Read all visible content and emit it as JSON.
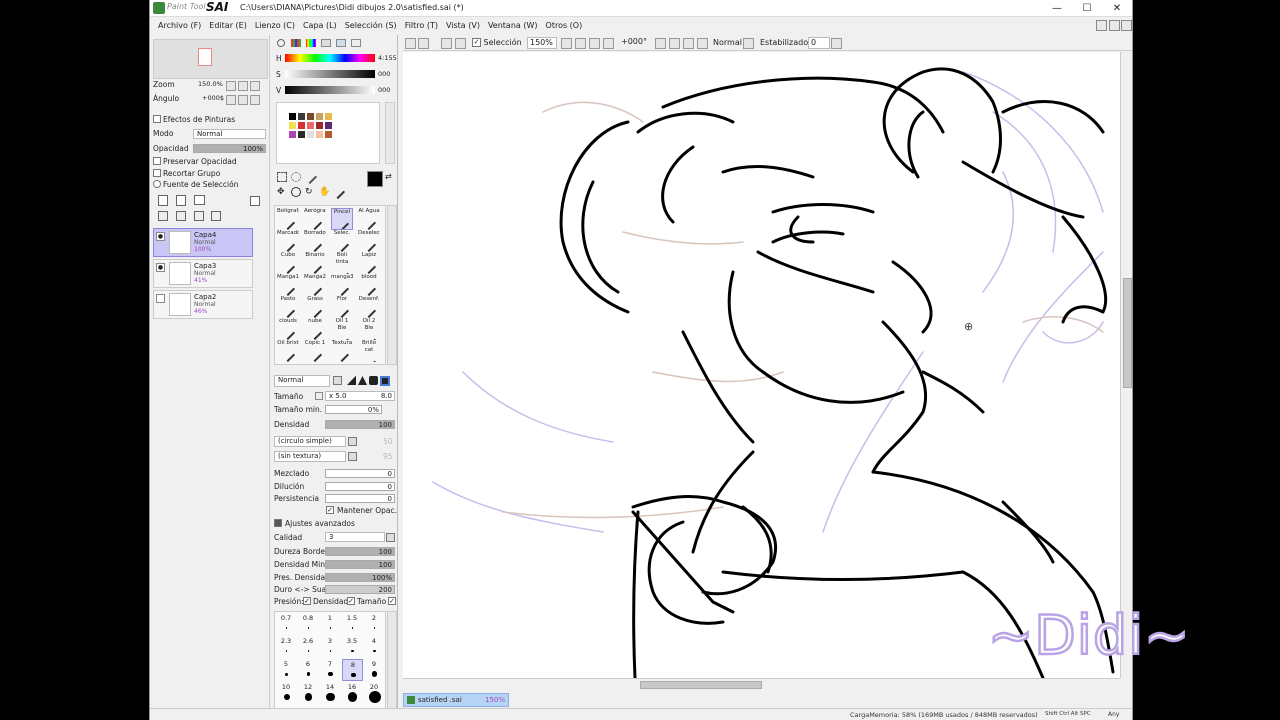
{
  "window": {
    "brand": "Paint Tool",
    "app_name": "SAI",
    "title": "C:\\Users\\DIANA\\Pictures\\Didi dibujos 2.0\\satisfied.sai (*)",
    "controls": {
      "minimize": "—",
      "maximize": "☐",
      "close": "✕"
    }
  },
  "menu": [
    "Archivo (F)",
    "Editar (E)",
    "Lienzo (C)",
    "Capa (L)",
    "Selección (S)",
    "Filtro (T)",
    "Vista (V)",
    "Ventana (W)",
    "Otros (O)"
  ],
  "toolbar": {
    "selection_label": "Selección",
    "zoom": "150%",
    "angle": "+000°",
    "mode": "Normal",
    "stabilizer_label": "Estabilizador",
    "stabilizer_value": "0"
  },
  "navigator": {
    "zoom_label": "Zoom",
    "zoom_value": "150.0%",
    "angle_label": "Ángulo",
    "angle_value": "+000$"
  },
  "layer_panel": {
    "effects_label": "Efectos de Pinturas",
    "mode_label": "Modo",
    "mode_value": "Normal",
    "opacity_label": "Opacidad",
    "opacity_value": "100%",
    "preserve_opacity": "Preservar Opacidad",
    "clip_group": "Recortar Grupo",
    "selection_source": "Fuente de Selección",
    "layers": [
      {
        "name": "Capa4",
        "mode": "Normal",
        "opacity": "100%",
        "selected": true
      },
      {
        "name": "Capa3",
        "mode": "Normal",
        "opacity": "41%",
        "selected": false
      },
      {
        "name": "Capa2",
        "mode": "Normal",
        "opacity": "46%",
        "selected": false
      }
    ]
  },
  "color": {
    "h_label": "H",
    "h_value": "4:155",
    "s_label": "S",
    "s_value": "000",
    "v_label": "V",
    "v_value": "000",
    "swatches": [
      "#000000",
      "#3a3a3a",
      "#7a4a2a",
      "#c8a060",
      "#e8b84a",
      "#f0e050",
      "#d83030",
      "#e86a6a",
      "#9a2a2a",
      "#5a2a6a",
      "#a84ab0",
      "#2a2a2a",
      "#e0e0e0",
      "#f4c0a0",
      "#b85a30"
    ],
    "primary": "#000000"
  },
  "brushes": [
    "Bolígraf.",
    "Aerógraf.",
    "Pincel",
    "Al Agua",
    "Marcador",
    "Borrador",
    "Selec.",
    "Deselec.",
    "Cubo",
    "Binario",
    "Boli tinta",
    "Lapiz",
    "Manga1",
    "Manga2",
    "manga3",
    "blood",
    "Pasto",
    "Grass",
    "Flor",
    "Desenf.",
    "clouds",
    "nube",
    "Oil 1 Ble",
    "Oil 2 Ble",
    "Oil brist",
    "Copic 1",
    "Textura",
    "Brillo cat"
  ],
  "brush_settings": {
    "mode": "Normal",
    "size_label": "Tamaño",
    "size_mult": "x 5.0",
    "size_value": "8.0",
    "min_size_label": "Tamaño min.",
    "min_size_value": "0%",
    "density_label": "Densidad",
    "density_value": "100",
    "shape": "(circulo simple)",
    "shape_value": "50",
    "texture": "(sin textura)",
    "texture_value": "95",
    "blend_label": "Mezclado",
    "blend_value": "0",
    "dilution_label": "Dilución",
    "dilution_value": "0",
    "persistence_label": "Persistencia",
    "persistence_value": "0",
    "keep_opacity": "Mantener Opac.",
    "advanced_label": "Ajustes avanzados",
    "quality_label": "Calidad",
    "quality_value": "3",
    "edge_hardness_label": "Dureza Borde",
    "edge_hardness_value": "100",
    "min_density_label": "Densidad Min.",
    "min_density_value": "100",
    "pressure_density_label": "Pres. Densidad",
    "pressure_density_value": "100%",
    "hard_soft_label": "Duro <-> Suave",
    "hard_soft_value": "200",
    "pressure_label": "Presión:",
    "pressure_density_chk": "Densidad",
    "pressure_size_chk": "Tamaño"
  },
  "brush_sizes": {
    "rows": [
      [
        "0.7",
        "0.8",
        "1",
        "1.5",
        "2"
      ],
      [
        "2.3",
        "2.6",
        "3",
        "3.5",
        "4"
      ],
      [
        "5",
        "6",
        "7",
        "8",
        "9"
      ],
      [
        "10",
        "12",
        "14",
        "16",
        "20"
      ]
    ],
    "selected": "8"
  },
  "canvas_tab": {
    "name": "satisfied .sai",
    "zoom": "150%"
  },
  "status": {
    "memory": "CargaMemoria: 58% (169MB usados / 848MB reservados)",
    "keys": "Shift Ctrl Alt SPC",
    "any": "Any"
  },
  "watermark": "~Didi~"
}
